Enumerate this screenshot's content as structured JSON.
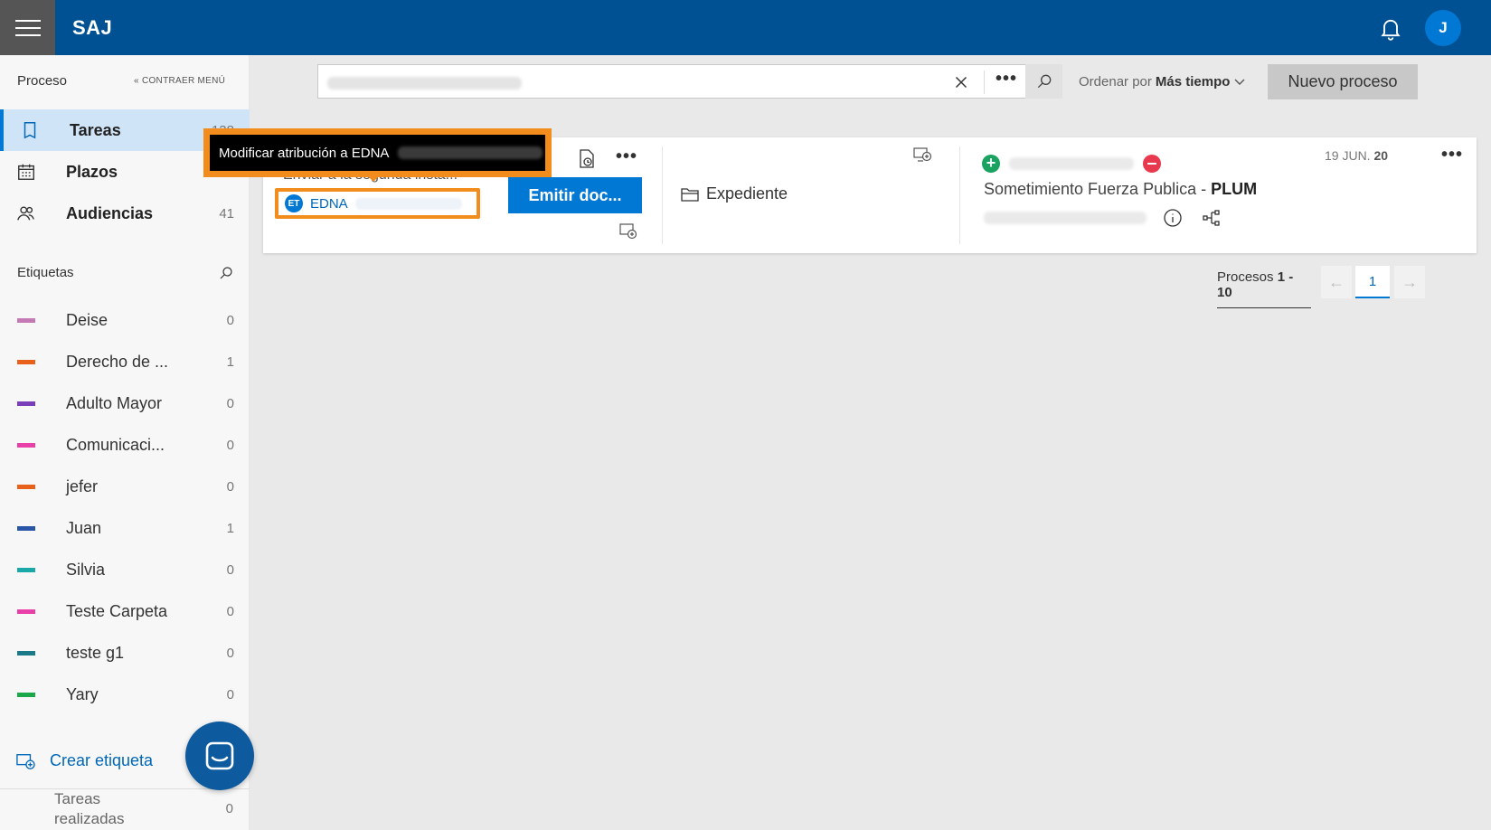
{
  "topbar": {
    "brand": "SAJ",
    "user_initial": "J"
  },
  "sidebar": {
    "section_title": "Proceso",
    "collapse_label": "CONTRAER MENÚ",
    "nav": [
      {
        "label": "Tareas",
        "count": "138"
      },
      {
        "label": "Plazos",
        "count": ""
      },
      {
        "label": "Audiencias",
        "count": "41"
      }
    ],
    "tags_title": "Etiquetas",
    "tags": [
      {
        "label": "Deise",
        "count": "0",
        "color": "#c47ab5"
      },
      {
        "label": "Derecho de ...",
        "count": "1",
        "color": "#e8611a"
      },
      {
        "label": "Adulto Mayor",
        "count": "0",
        "color": "#7a3fb8"
      },
      {
        "label": "Comunicaci...",
        "count": "0",
        "color": "#e83fa8"
      },
      {
        "label": "jefer",
        "count": "0",
        "color": "#e8611a"
      },
      {
        "label": "Juan",
        "count": "1",
        "color": "#2a56a8"
      },
      {
        "label": "Silvia",
        "count": "0",
        "color": "#1aa8a8"
      },
      {
        "label": "Teste Carpeta",
        "count": "0",
        "color": "#e83fa8"
      },
      {
        "label": "teste g1",
        "count": "0",
        "color": "#1a7a8a"
      },
      {
        "label": "Yary",
        "count": "0",
        "color": "#1aa84a"
      }
    ],
    "create_tag": "Crear etiqueta",
    "done_tasks": "Tareas realizadas",
    "done_count": "0"
  },
  "toolbar": {
    "search_placeholder": "",
    "sort_prefix": "Ordenar por",
    "sort_value": "Más tiempo",
    "new_button": "Nuevo proceso"
  },
  "card": {
    "task_text": "Enviar a la segunda insta...",
    "assignee_initials": "ET",
    "assignee_name": "EDNA",
    "emit_button": "Emitir doc...",
    "expediente": "Expediente",
    "process_title": "Sometimiento Fuerza Publica - ",
    "process_code": "PLUM",
    "date": "19 JUN.",
    "date_year": "20"
  },
  "tooltip": {
    "text": "Modificar atribución a EDNA"
  },
  "pagination": {
    "label": "Procesos",
    "range": "1 - 10",
    "page": "1",
    "prev": "←",
    "next": "→"
  },
  "colors": {
    "brand": "#005193",
    "accent": "#0078d4",
    "highlight": "#f28c1c"
  }
}
